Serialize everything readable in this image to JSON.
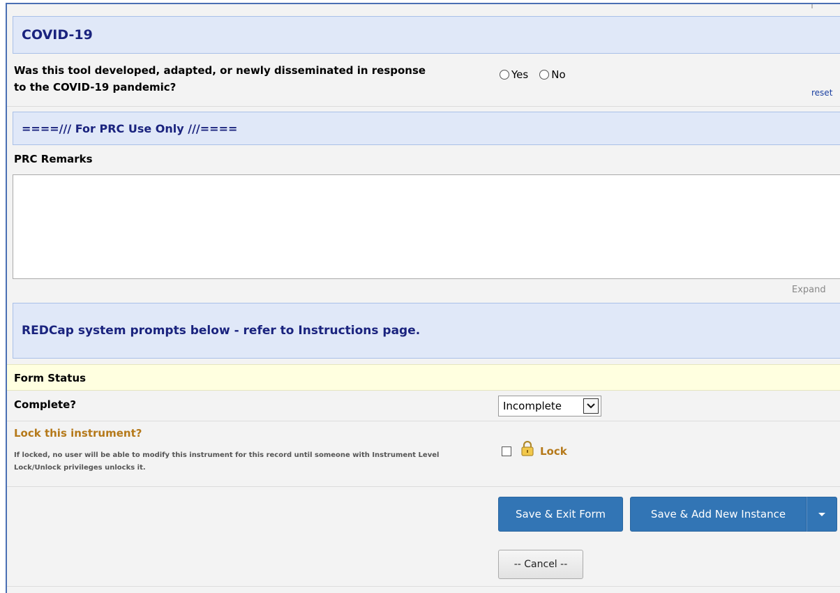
{
  "section_covid": {
    "title": "COVID-19"
  },
  "covid_question": {
    "text": "Was this tool developed, adapted, or newly disseminated in response to the COVID-19 pandemic?",
    "options": [
      "Yes",
      "No"
    ],
    "selected": null,
    "reset_label": "reset"
  },
  "section_prc": {
    "title": "====/// For PRC Use Only ///===="
  },
  "prc_remarks": {
    "label": "PRC Remarks",
    "value": "",
    "expand_label": "Expand"
  },
  "section_system": {
    "title": "REDCap system prompts below - refer to Instructions page."
  },
  "form_status": {
    "header": "Form Status",
    "complete_label": "Complete?",
    "complete_value": "Incomplete"
  },
  "lock": {
    "question": "Lock this instrument?",
    "note": "If locked, no user will be able to modify this instrument for this record until someone with Instrument Level Lock/Unlock privileges unlocks it.",
    "label": "Lock",
    "checked": false
  },
  "buttons": {
    "save_exit": "Save & Exit Form",
    "save_add": "Save & Add New Instance",
    "cancel": "-- Cancel --"
  },
  "colors": {
    "header_bg": "#e0e8f8",
    "header_text": "#1a237e",
    "button_blue": "#3275b5",
    "lock_gold": "#b5791a",
    "status_bg": "#ffffe0"
  }
}
